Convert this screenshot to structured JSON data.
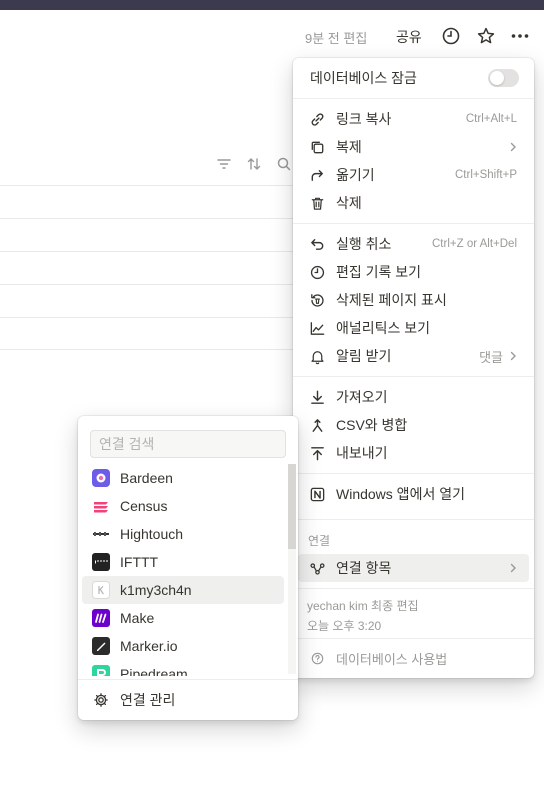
{
  "header": {
    "edited_label": "9분 전 편집",
    "share_label": "공유",
    "history_icon": "clock-icon",
    "favorite_icon": "star-icon",
    "more_icon": "more-horizontal-icon"
  },
  "db_toolbar": {
    "icons": [
      "filter-icon",
      "sort-icon",
      "search-icon"
    ]
  },
  "main_menu": {
    "lock_label": "데이터베이스 잠금",
    "lock_on": false,
    "group1": [
      {
        "label": "링크 복사",
        "shortcut": "Ctrl+Alt+L",
        "icon": "link-icon"
      },
      {
        "label": "복제",
        "shortcut": "",
        "icon": "duplicate-icon",
        "has_submenu": true
      },
      {
        "label": "옮기기",
        "shortcut": "Ctrl+Shift+P",
        "icon": "move-icon"
      },
      {
        "label": "삭제",
        "shortcut": "",
        "icon": "trash-icon"
      }
    ],
    "group2": [
      {
        "label": "실행 취소",
        "shortcut": "Ctrl+Z or Alt+Del",
        "icon": "undo-icon"
      },
      {
        "label": "편집 기록 보기",
        "shortcut": "",
        "icon": "clock-icon"
      },
      {
        "label": "삭제된 페이지 표시",
        "shortcut": "",
        "icon": "trash-history-icon"
      },
      {
        "label": "애널리틱스 보기",
        "shortcut": "",
        "icon": "analytics-icon"
      },
      {
        "label": "알림 받기",
        "suffix": "댓글",
        "icon": "bell-icon",
        "has_submenu": true
      }
    ],
    "group3": [
      {
        "label": "가져오기",
        "icon": "import-icon"
      },
      {
        "label": "CSV와 병합",
        "icon": "merge-icon"
      },
      {
        "label": "내보내기",
        "icon": "export-icon"
      }
    ],
    "open_in_app": {
      "label": "Windows 앱에서 열기",
      "icon": "notion-icon"
    },
    "connections_caption": "연결",
    "connections_item": {
      "label": "연결 항목",
      "icon": "connections-icon",
      "has_submenu": true
    },
    "last_edited_by": "yechan kim 최종 편집",
    "last_edited_time": "오늘 오후 3:20",
    "help_label": "데이터베이스 사용법",
    "help_icon": "help-circle-icon"
  },
  "connections_menu": {
    "search_placeholder": "연결 검색",
    "search_value": "",
    "items": [
      {
        "label": "Bardeen",
        "color": "#6c5ce7"
      },
      {
        "label": "Census",
        "color": "#f0437a"
      },
      {
        "label": "Hightouch",
        "color": "#111111"
      },
      {
        "label": "IFTTT",
        "color": "#222222"
      },
      {
        "label": "k1my3ch4n",
        "color": "#d9d9d6"
      },
      {
        "label": "Make",
        "color": "#6d00cc"
      },
      {
        "label": "Marker.io",
        "color": "#2b2b2b"
      },
      {
        "label": "Pipedream",
        "color": "#2ed69e"
      }
    ],
    "manage_label": "연결 관리",
    "manage_icon": "gear-icon"
  }
}
